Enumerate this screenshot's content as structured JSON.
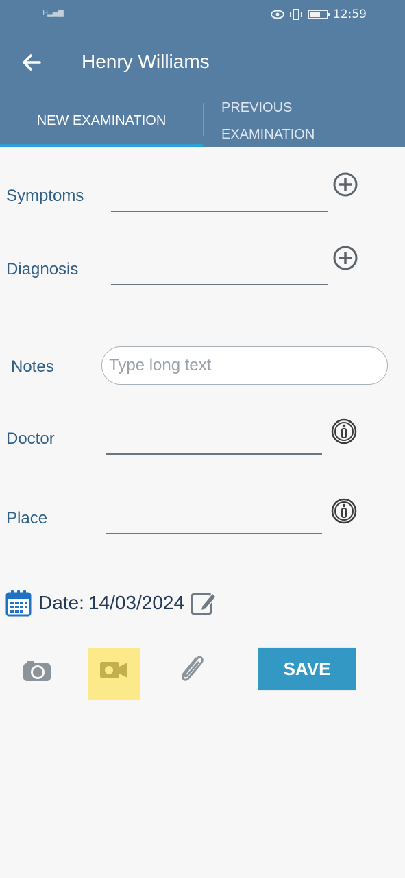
{
  "status_bar": {
    "signal": "H",
    "time": "12:59"
  },
  "header": {
    "title": "Henry Williams"
  },
  "tabs": [
    {
      "label": "NEW EXAMINATION"
    },
    {
      "label": "PREVIOUS EXAMINATION"
    }
  ],
  "form": {
    "symptoms_label": "Symptoms",
    "diagnosis_label": "Diagnosis",
    "notes_label": "Notes",
    "notes_placeholder": "Type long text",
    "doctor_label": "Doctor",
    "place_label": "Place",
    "date_label": "Date:",
    "date_value": "14/03/2024"
  },
  "toolbar": {
    "save_label": "SAVE"
  },
  "colors": {
    "header": "#567da2",
    "tab_indicator": "#2f9fd8",
    "save_button": "#3398c4",
    "highlight": "#fbe98a"
  }
}
